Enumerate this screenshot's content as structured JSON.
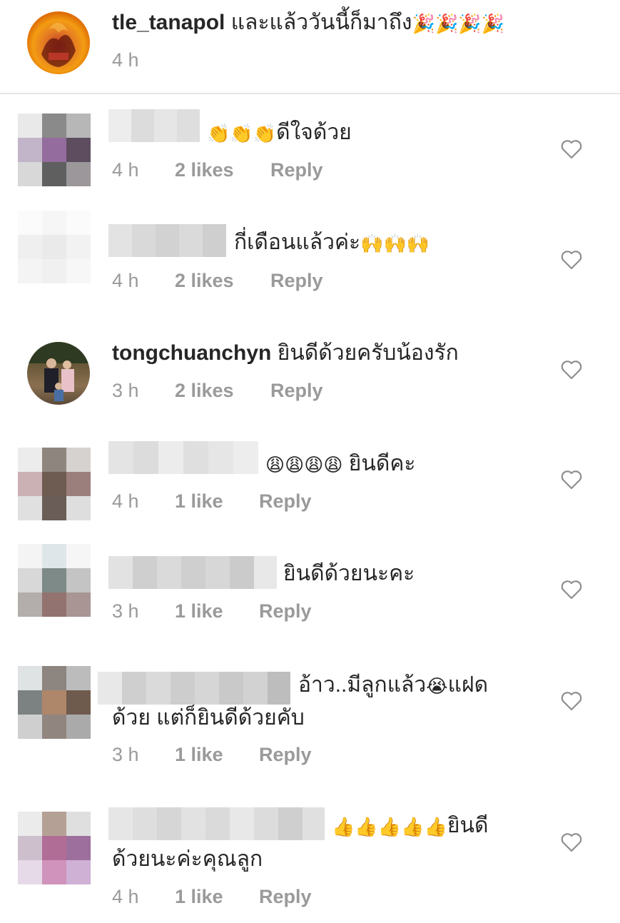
{
  "header": {
    "username": "tle_tanapol",
    "text": "และแล้ววันนี้ก็มาถึง",
    "emojis": "🎉🎉🎉🎉",
    "time": "4 h"
  },
  "comments": [
    {
      "pre_emojis": "👏👏👏",
      "text": "ดีใจด้วย",
      "post_emojis": "",
      "time": "4 h",
      "likes": "2 likes",
      "reply": "Reply"
    },
    {
      "pre_emojis": "",
      "text": "กี่เดือนแล้วค่ะ",
      "post_emojis": "🙌🙌🙌",
      "time": "4 h",
      "likes": "2 likes",
      "reply": "Reply"
    },
    {
      "username": "tongchuanchyn",
      "text": "ยินดีด้วยครับน้องรัก",
      "time": "3 h",
      "likes": "2 likes",
      "reply": "Reply"
    },
    {
      "pre_emojis": "😩😩😩😩",
      "text": "ยินดีคะ",
      "time": "4 h",
      "likes": "1 like",
      "reply": "Reply"
    },
    {
      "text": "ยินดีด้วยนะคะ",
      "time": "3 h",
      "likes": "1 like",
      "reply": "Reply"
    },
    {
      "text_a": "อ้าว..มีลูกแล้ว",
      "emoji": "😭",
      "text_b": "แฝด",
      "line2": "ด้วย แต่ก็ยินดีด้วยคับ",
      "time": "3 h",
      "likes": "1 like",
      "reply": "Reply"
    },
    {
      "pre_emojis": "👍👍👍👍👍",
      "text": "ยินดี",
      "line2": "ด้วยนะค่ะคุณลูก",
      "time": "4 h",
      "likes": "1 like",
      "reply": "Reply"
    }
  ],
  "colors": {
    "meta": "#9a9a9a",
    "text": "#262626",
    "divider": "#e6e6e6"
  }
}
